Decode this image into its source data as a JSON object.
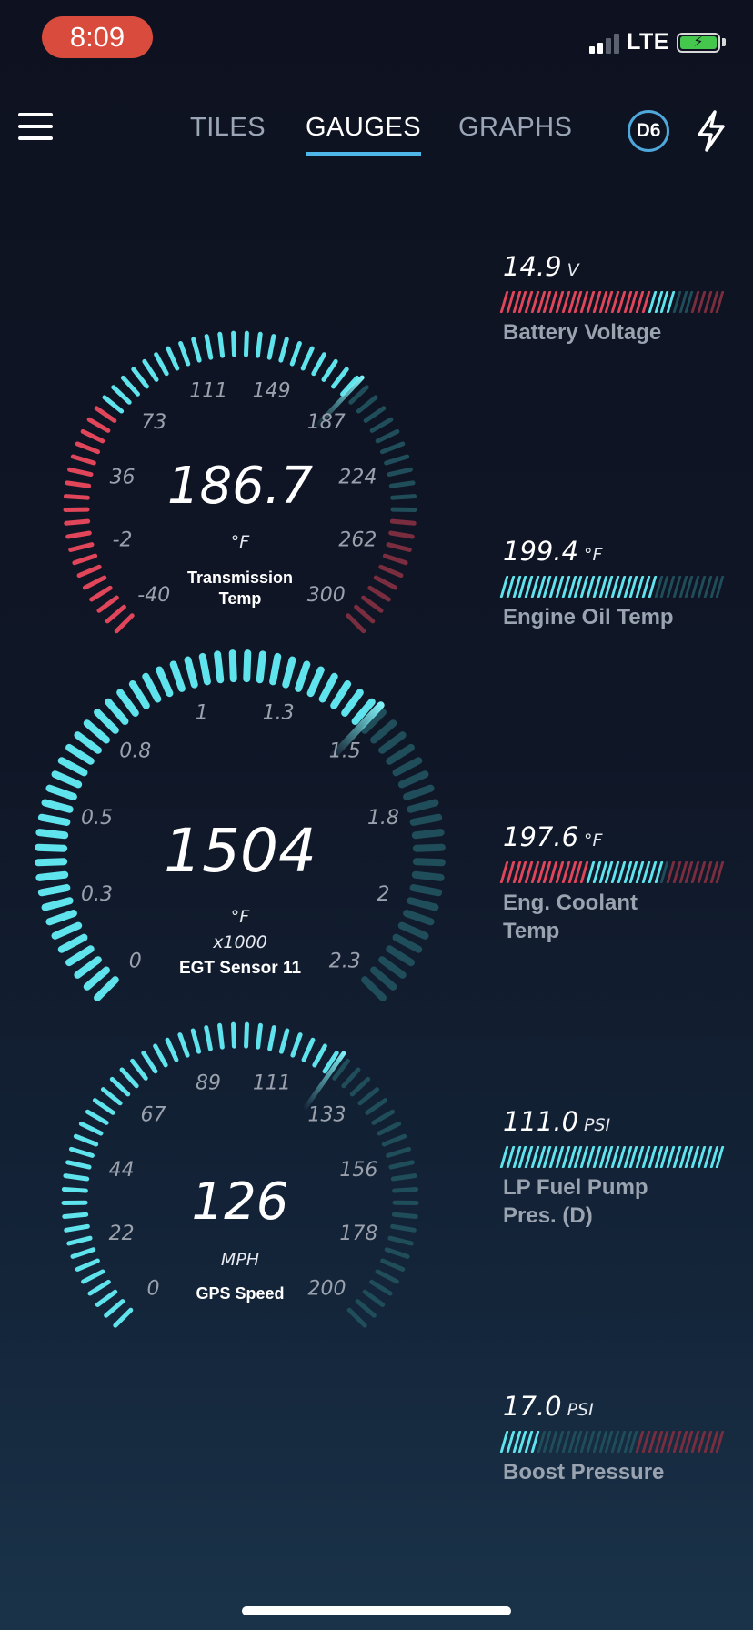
{
  "status": {
    "time": "8:09",
    "network": "LTE"
  },
  "header": {
    "tabs": [
      {
        "label": "TILES",
        "active": false
      },
      {
        "label": "GAUGES",
        "active": true
      },
      {
        "label": "GRAPHS",
        "active": false
      }
    ],
    "device_badge": "D6",
    "accent_color": "#4fb7e8"
  },
  "icons": [
    "menu-icon",
    "lightning-bolt-icon",
    "signal-icon",
    "battery-charging-icon"
  ],
  "colors": {
    "cyan": "#5fe3ec",
    "cyan_dim": "#1f4d5a",
    "red": "#e0455a",
    "red_dim": "#7a2d3e"
  },
  "gauges": [
    {
      "value": "186.7",
      "value_fraction": 0.66,
      "unit": "°F",
      "multiplier": "",
      "name_lines": [
        "Transmission",
        "Temp"
      ],
      "ticks": [
        "-40",
        "-2",
        "36",
        "73",
        "111",
        "149",
        "187",
        "224",
        "262",
        "300"
      ],
      "zones": [
        {
          "from": 0,
          "to": 0.3,
          "color": "red"
        },
        {
          "from": 0.3,
          "to": 0.85,
          "color": "cyan"
        },
        {
          "from": 0.85,
          "to": 1,
          "color": "red"
        }
      ]
    },
    {
      "value": "1504",
      "value_fraction": 0.66,
      "unit": "°F",
      "multiplier": "x1000",
      "name_lines": [
        "EGT Sensor 11"
      ],
      "ticks": [
        "0",
        "0.3",
        "0.5",
        "0.8",
        "1",
        "1.3",
        "1.5",
        "1.8",
        "2",
        "2.3"
      ],
      "zones": [
        {
          "from": 0,
          "to": 1,
          "color": "cyan"
        }
      ]
    },
    {
      "value": "126",
      "value_fraction": 0.63,
      "unit": "MPH",
      "multiplier": "",
      "name_lines": [
        "GPS Speed"
      ],
      "ticks": [
        "0",
        "22",
        "44",
        "67",
        "89",
        "111",
        "133",
        "156",
        "178",
        "200"
      ],
      "zones": [
        {
          "from": 0,
          "to": 1,
          "color": "cyan"
        }
      ]
    }
  ],
  "bars": [
    {
      "value": "14.9",
      "unit": "V",
      "label": "Battery Voltage",
      "fill_fraction": 0.78,
      "zones": [
        {
          "from": 0,
          "to": 0.67,
          "color": "red"
        },
        {
          "from": 0.67,
          "to": 0.85,
          "color": "cyan"
        },
        {
          "from": 0.85,
          "to": 1,
          "color": "red"
        }
      ]
    },
    {
      "value": "199.4",
      "unit": "°F",
      "label": "Engine Oil Temp",
      "fill_fraction": 0.7,
      "zones": [
        {
          "from": 0,
          "to": 1,
          "color": "cyan"
        }
      ]
    },
    {
      "value": "197.6",
      "unit": "°F",
      "label": "Eng. Coolant Temp",
      "fill_fraction": 0.72,
      "zones": [
        {
          "from": 0,
          "to": 0.4,
          "color": "red"
        },
        {
          "from": 0.4,
          "to": 0.75,
          "color": "cyan"
        },
        {
          "from": 0.75,
          "to": 1,
          "color": "red"
        }
      ]
    },
    {
      "value": "111.0",
      "unit": "PSI",
      "label": "LP Fuel Pump Pres. (D)",
      "fill_fraction": 1.0,
      "zones": [
        {
          "from": 0,
          "to": 1,
          "color": "cyan"
        }
      ]
    },
    {
      "value": "17.0",
      "unit": "PSI",
      "label": "Boost Pressure",
      "fill_fraction": 0.18,
      "zones": [
        {
          "from": 0,
          "to": 0.6,
          "color": "cyan"
        },
        {
          "from": 0.6,
          "to": 1,
          "color": "red"
        }
      ]
    }
  ]
}
